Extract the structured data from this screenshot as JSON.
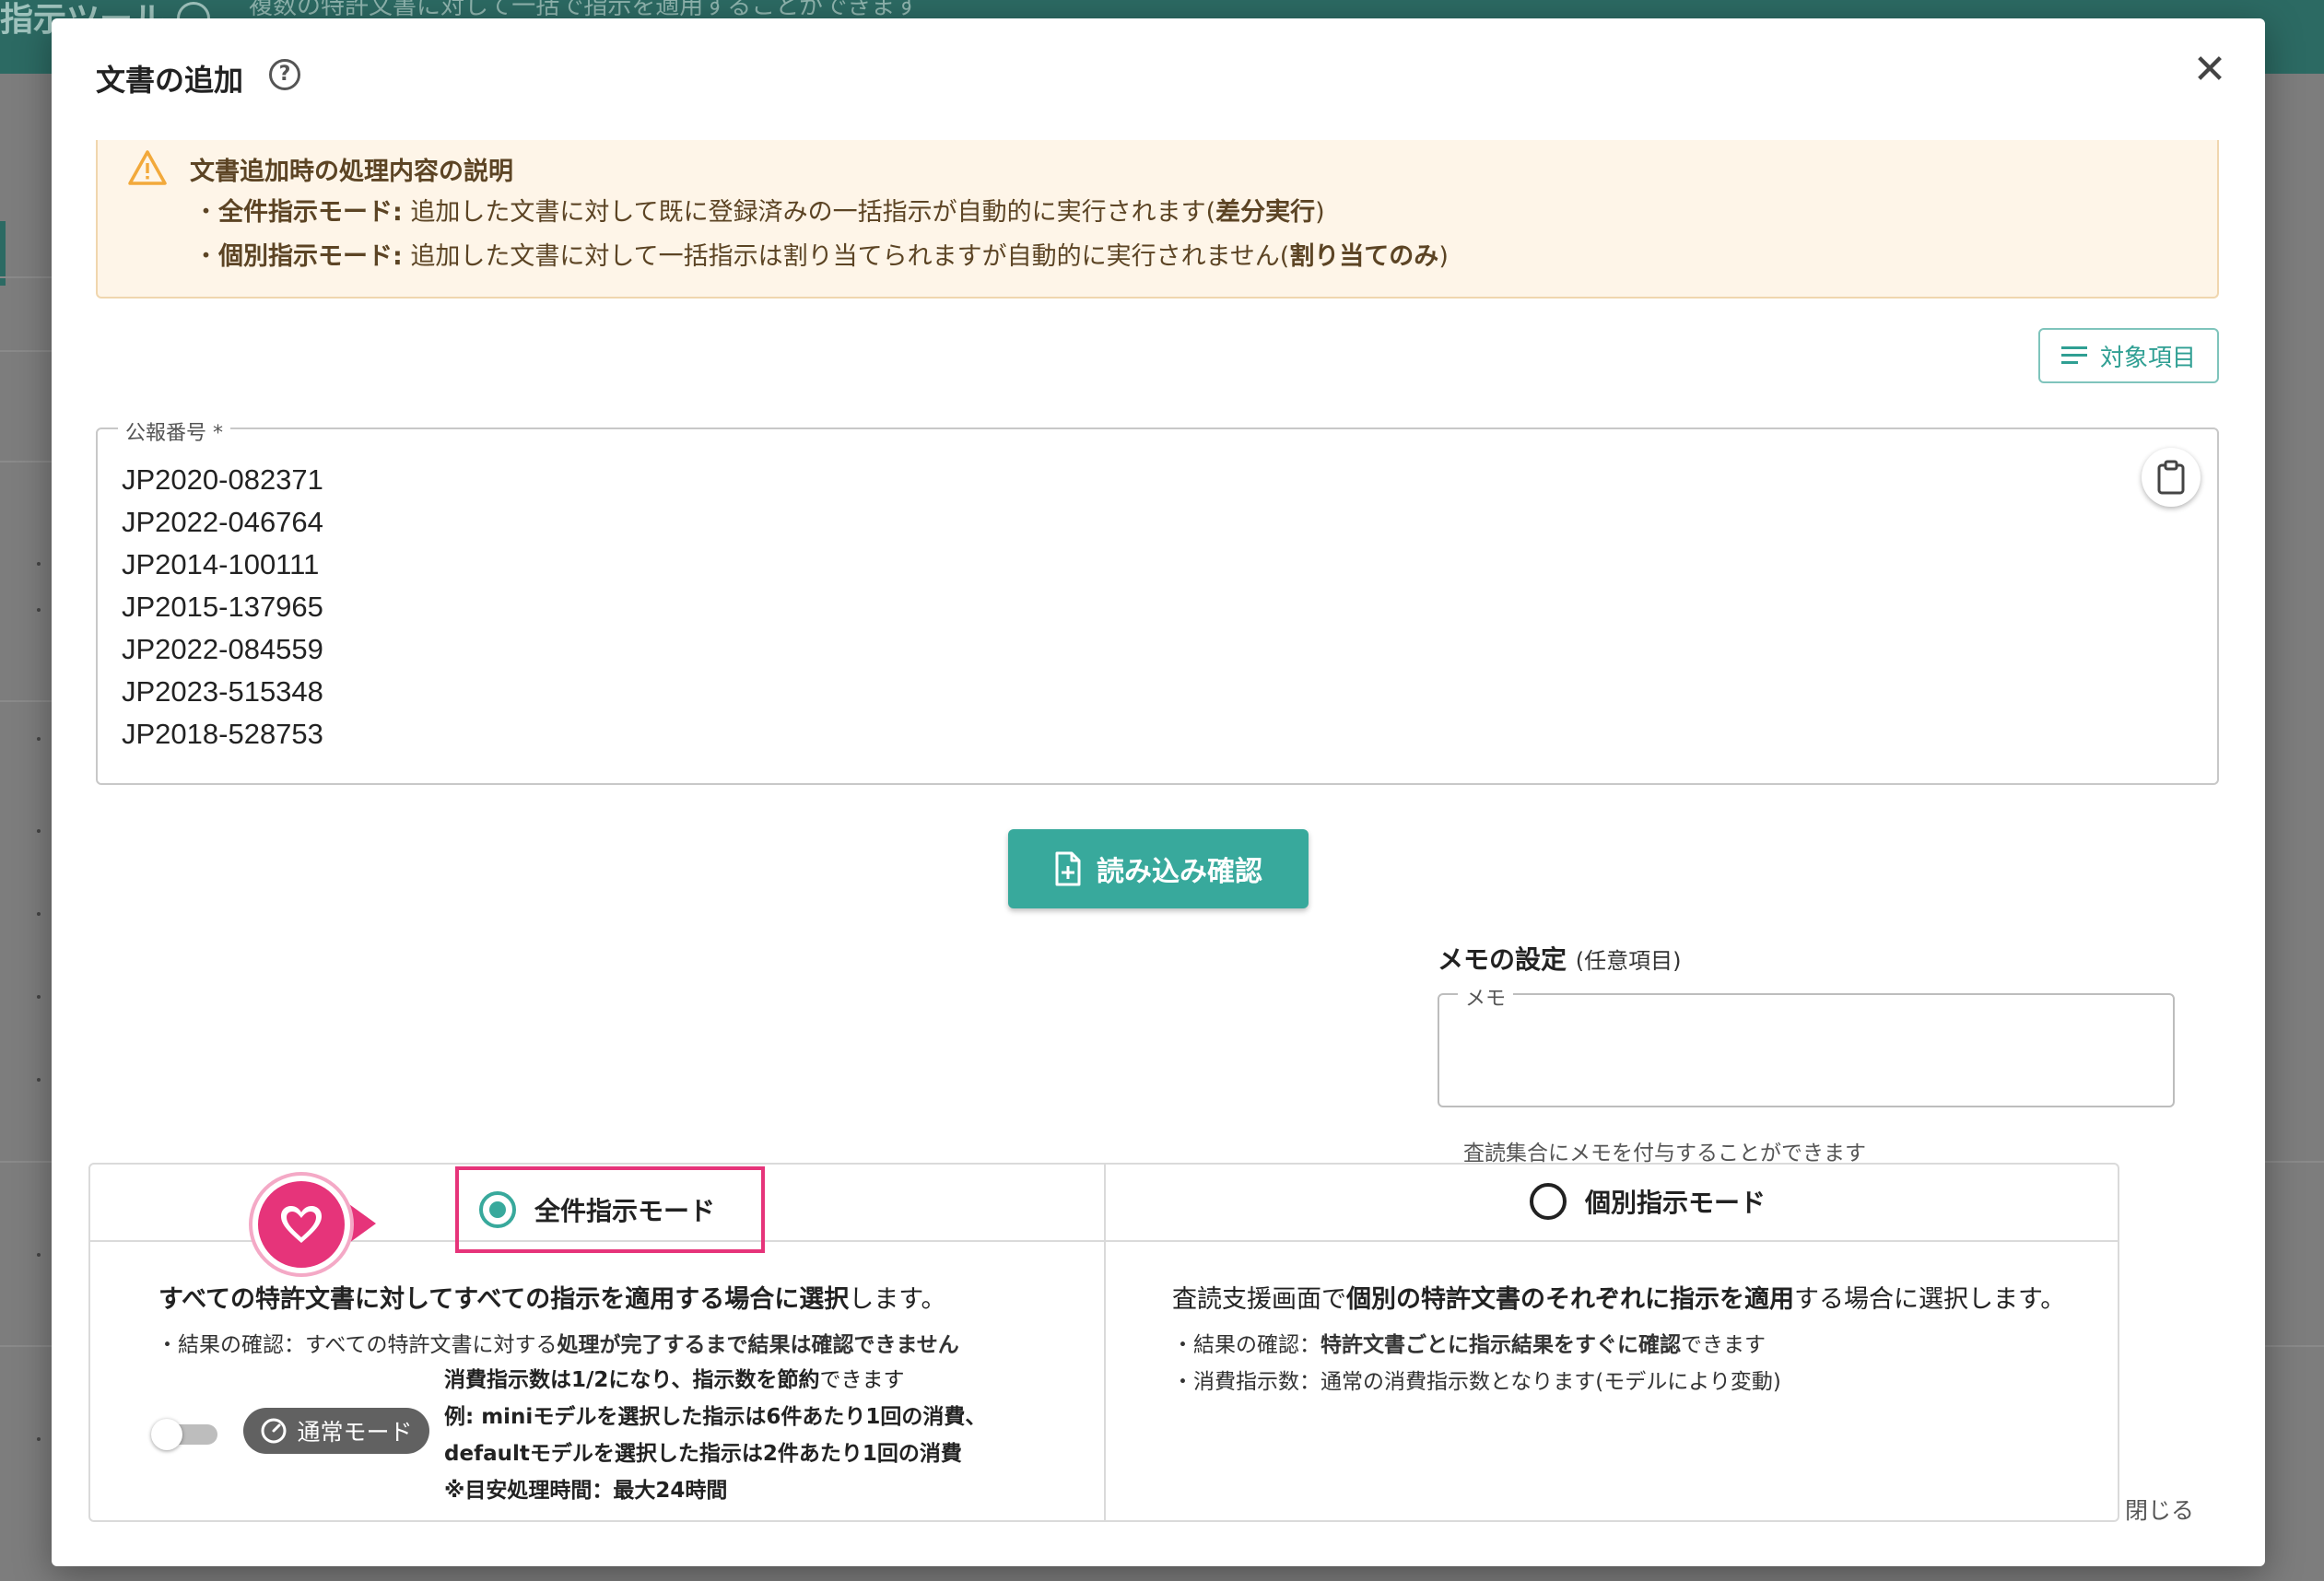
{
  "background": {
    "app_title": "指示ツール",
    "app_subtitle": "複数の特許文書に対して一括で指示を適用することができます"
  },
  "modal": {
    "title": "文書の追加",
    "notice": {
      "title": "文書追加時の処理内容の説明",
      "line1_prefix": "・",
      "line1_mode": "全件指示モード:",
      "line1_text": " 追加した文書に対して既に登録済みの一括指示が自動的に実行されます(",
      "line1_bold": "差分実行",
      "line1_suffix": ")",
      "line2_prefix": "・",
      "line2_mode": "個別指示モード:",
      "line2_text": " 追加した文書に対して一括指示は割り当てられますが自動的に実行されません(",
      "line2_bold": "割り当てのみ",
      "line2_suffix": ")"
    },
    "target_button_label": "対象項目",
    "publication_field": {
      "label": "公報番号 *",
      "values": [
        "JP2020-082371",
        "JP2022-046764",
        "JP2014-100111",
        "JP2015-137965",
        "JP2022-084559",
        "JP2023-515348",
        "JP2018-528753"
      ]
    },
    "load_button_label": "読み込み確認",
    "memo": {
      "title": "メモの設定",
      "title_note": "(任意項目)",
      "field_label": "メモ",
      "value": "",
      "helper": "査読集合にメモを付与することができます"
    },
    "modes": {
      "all": {
        "label": "全件指示モード",
        "selected": true,
        "desc_a": "すべての特許文書に対してすべての指示を適用する場合に選択",
        "desc_b": "します。",
        "sub1_a": "・結果の確認：すべての特許文書に対する",
        "sub1_b": "処理が完了するまで結果は確認できません",
        "toggle_on": false,
        "chip_label": "通常モード",
        "info1_a": "消費指示数は1/2になり、指示数を節約",
        "info1_b": "できます",
        "info2": "例: miniモデルを選択した指示は6件あたり1回の消費、",
        "info3": "defaultモデルを選択した指示は2件あたり1回の消費",
        "info4": "※目安処理時間：最大24時間"
      },
      "individual": {
        "label": "個別指示モード",
        "selected": false,
        "desc_a": "査読支援画面で",
        "desc_b": "個別の特許文書のそれぞれに指示を適用",
        "desc_c": "する場合に選択します。",
        "sub1_a": "・結果の確認：",
        "sub1_b": "特許文書ごとに指示結果をすぐに確認",
        "sub1_c": "できます",
        "sub2": "・消費指示数：通常の消費指示数となります(モデルにより変動)"
      }
    },
    "close_label": "閉じる"
  },
  "colors": {
    "accent": "#38a99c",
    "highlight": "#e6347a",
    "notice_bg": "#fef5e8",
    "header_bg": "#2c6a63"
  }
}
